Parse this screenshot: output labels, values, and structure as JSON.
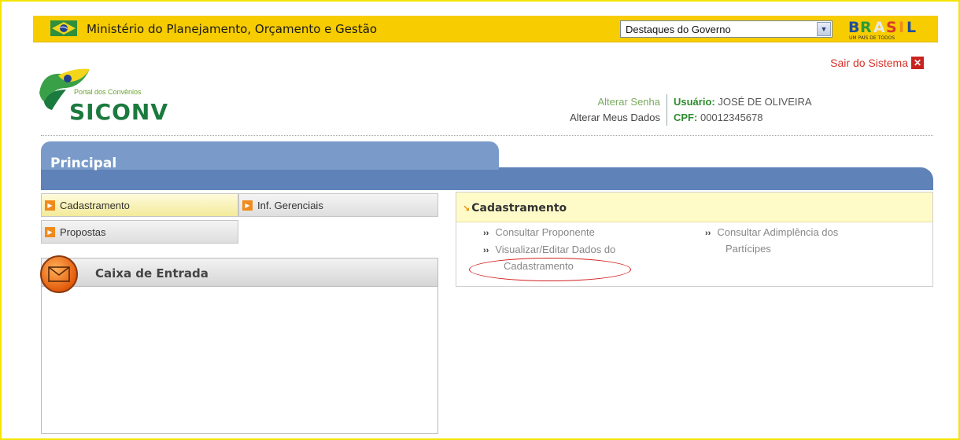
{
  "gov_bar": {
    "ministry": "Ministério do Planejamento, Orçamento e Gestão",
    "destaques_select": "Destaques do Governo",
    "brasil_logo": "BRASIL",
    "brasil_tagline": "UM PAÍS DE TODOS"
  },
  "logo": {
    "portal": "Portal dos Convênios",
    "name": "SICONV"
  },
  "header": {
    "logout_label": "Sair do Sistema",
    "change_password": "Alterar Senha",
    "change_data": "Alterar Meus Dados",
    "user_label": "Usuário:",
    "user_name": "JOSÉ DE OLIVEIRA",
    "cpf_label": "CPF:",
    "cpf_value": "00012345678"
  },
  "principal_tab": "Principal",
  "menu": {
    "items": [
      {
        "label": "Cadastramento",
        "active": true
      },
      {
        "label": "Inf. Gerenciais",
        "active": false
      },
      {
        "label": "Propostas",
        "active": false
      }
    ]
  },
  "inbox": {
    "title": "Caixa de Entrada"
  },
  "panel": {
    "title": "Cadastramento",
    "links": [
      {
        "label": "Consultar Proponente"
      },
      {
        "label_line1": "Visualizar/Editar Dados do",
        "label_line2": "Cadastramento"
      },
      {
        "label_line1": "Consultar Adimplência dos",
        "label_line2": "Partícipes"
      }
    ]
  },
  "icons": {
    "flag": "brazil-flag-icon",
    "dropdown": "chevron-down-icon",
    "close": "close-icon",
    "menu_arrow": "orange-arrow-icon",
    "envelope": "envelope-icon",
    "bullet": "double-chevron-icon"
  },
  "colors": {
    "gov_bar": "#f7cc00",
    "principal_tab": "#7a9bc9",
    "blue_bar": "#5f82b8",
    "panel_header": "#fffbc8",
    "siconv_green": "#1b7a3e",
    "highlight_circle": "#d21f1f"
  }
}
